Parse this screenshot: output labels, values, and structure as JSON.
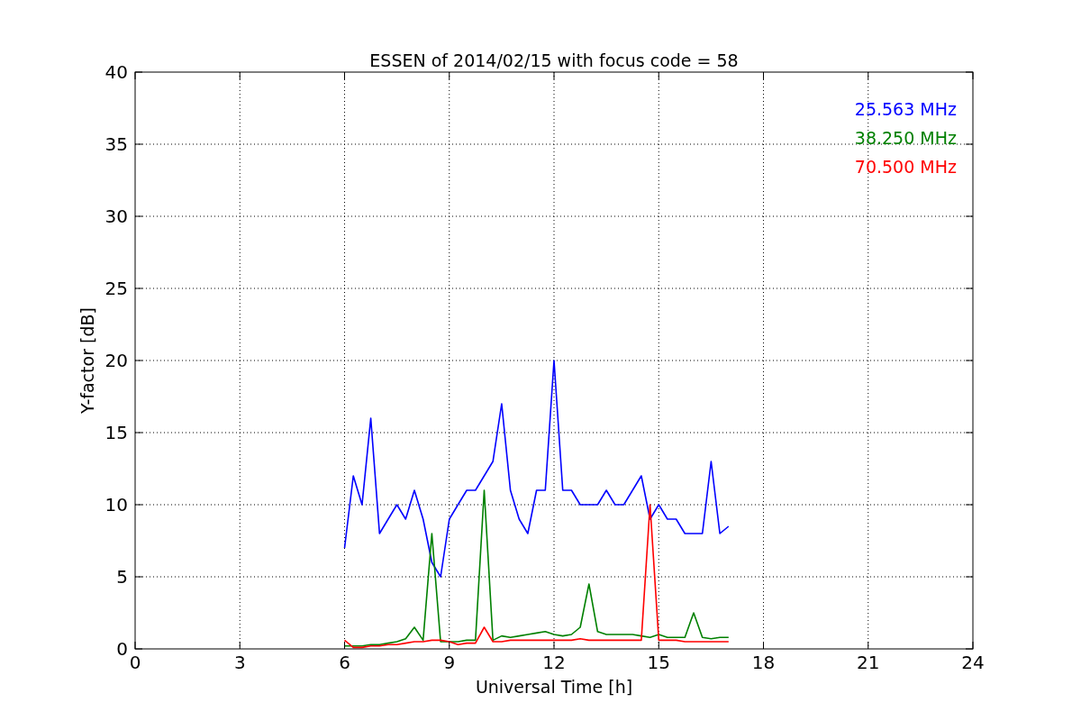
{
  "chart_data": {
    "type": "line",
    "title": "ESSEN of 2014/02/15 with focus code = 58",
    "xlabel": "Universal Time [h]",
    "ylabel": "Y-factor [dB]",
    "x": [
      6,
      6.25,
      6.5,
      6.75,
      7,
      7.25,
      7.5,
      7.75,
      8,
      8.25,
      8.5,
      8.75,
      9,
      9.25,
      9.5,
      9.75,
      10,
      10.25,
      10.5,
      10.75,
      11,
      11.25,
      11.5,
      11.75,
      12,
      12.25,
      12.5,
      12.75,
      13,
      13.25,
      13.5,
      13.75,
      14,
      14.25,
      14.5,
      14.75,
      15,
      15.25,
      15.5,
      15.75,
      16,
      16.25,
      16.5,
      16.75,
      17
    ],
    "series": [
      {
        "name": "25.563 MHz",
        "color": "#0000ff",
        "values": [
          7,
          12,
          10,
          16,
          8,
          9,
          10,
          9,
          11,
          9,
          6,
          5,
          9,
          10,
          11,
          11,
          12,
          13,
          17,
          11,
          9,
          8,
          11,
          11,
          20,
          11,
          11,
          10,
          10,
          10,
          11,
          10,
          10,
          11,
          12,
          9,
          10,
          9,
          9,
          8,
          8,
          8,
          13,
          8,
          8.5
        ]
      },
      {
        "name": "38.250 MHz",
        "color": "#008000",
        "values": [
          0.2,
          0.2,
          0.2,
          0.3,
          0.3,
          0.4,
          0.5,
          0.7,
          1.5,
          0.6,
          8,
          0.5,
          0.5,
          0.5,
          0.6,
          0.6,
          11,
          0.6,
          0.9,
          0.8,
          0.9,
          1,
          1.1,
          1.2,
          1,
          0.9,
          1,
          1.5,
          4.5,
          1.2,
          1,
          1,
          1,
          1,
          0.9,
          0.8,
          1,
          0.8,
          0.8,
          0.8,
          2.5,
          0.8,
          0.7,
          0.8,
          0.8
        ]
      },
      {
        "name": "70.500 MHz",
        "color": "#ff0000",
        "values": [
          0.6,
          0.1,
          0.1,
          0.2,
          0.2,
          0.3,
          0.3,
          0.4,
          0.5,
          0.5,
          0.6,
          0.6,
          0.5,
          0.3,
          0.4,
          0.4,
          1.5,
          0.5,
          0.5,
          0.6,
          0.6,
          0.6,
          0.6,
          0.6,
          0.6,
          0.6,
          0.6,
          0.7,
          0.6,
          0.6,
          0.6,
          0.6,
          0.6,
          0.6,
          0.6,
          10,
          0.6,
          0.6,
          0.6,
          0.5,
          0.5,
          0.5,
          0.5,
          0.5,
          0.5
        ]
      }
    ],
    "grid": true,
    "xlim": [
      0,
      24
    ],
    "ylim": [
      0,
      40
    ],
    "xticks": [
      0,
      3,
      6,
      9,
      12,
      15,
      18,
      21,
      24
    ],
    "yticks": [
      0,
      5,
      10,
      15,
      20,
      25,
      30,
      35,
      40
    ]
  }
}
